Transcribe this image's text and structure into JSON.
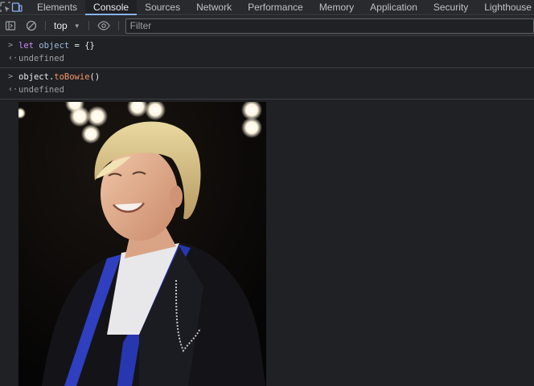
{
  "tabbar": {
    "inspect_icon": "inspect-element-icon",
    "device_icon": "device-toolbar-icon",
    "tabs": [
      {
        "label": "Elements",
        "active": false
      },
      {
        "label": "Console",
        "active": true
      },
      {
        "label": "Sources",
        "active": false
      },
      {
        "label": "Network",
        "active": false
      },
      {
        "label": "Performance",
        "active": false
      },
      {
        "label": "Memory",
        "active": false
      },
      {
        "label": "Application",
        "active": false
      },
      {
        "label": "Security",
        "active": false
      },
      {
        "label": "Lighthouse",
        "active": false
      }
    ]
  },
  "toolbar": {
    "sidebar_icon": "sidebar-toggle-icon",
    "clear_icon": "clear-console-icon",
    "context": "top",
    "eye_icon": "eye-icon",
    "filter_placeholder": "Filter"
  },
  "console": {
    "entries": [
      {
        "input": {
          "keyword": "let",
          "var": "object",
          "rest": " = {}"
        },
        "result": "undefined"
      },
      {
        "input": {
          "object": "object",
          "dot": ".",
          "method": "toBowie",
          "parens": "()"
        },
        "result": "undefined"
      }
    ],
    "image": {
      "subject": "photo of a smiling blond man in a dark jacket on stage"
    }
  },
  "colors": {
    "background": "#202124",
    "toolbar": "#292a2d",
    "active_tab_underline": "#8ab4f8",
    "keyword": "#c58af9",
    "variable": "#9bbbdc",
    "method": "#f29766"
  }
}
